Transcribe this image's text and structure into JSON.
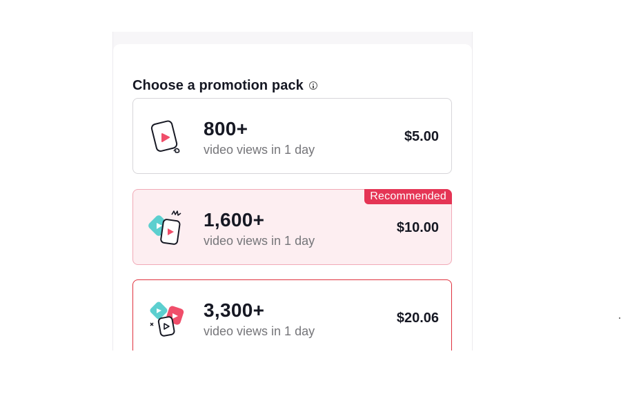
{
  "section": {
    "title": "Choose a promotion pack",
    "info_icon": "info-icon"
  },
  "packs": [
    {
      "views": "800+",
      "description": "video views in 1 day",
      "price": "$5.00",
      "icon": "single-video-card-icon",
      "state": "default"
    },
    {
      "views": "1,600+",
      "description": "video views in 1 day",
      "price": "$10.00",
      "icon": "two-video-cards-icon",
      "state": "recommended",
      "badge": "Recommended"
    },
    {
      "views": "3,300+",
      "description": "video views in 1 day",
      "price": "$20.06",
      "icon": "three-video-cards-icon",
      "state": "selected"
    }
  ],
  "colors": {
    "accent_red": "#e0303d",
    "badge_pink": "#e53555",
    "recommended_bg": "#fdeef1",
    "teal": "#5ccfcf",
    "text_primary": "#161823",
    "text_secondary": "#757579"
  }
}
